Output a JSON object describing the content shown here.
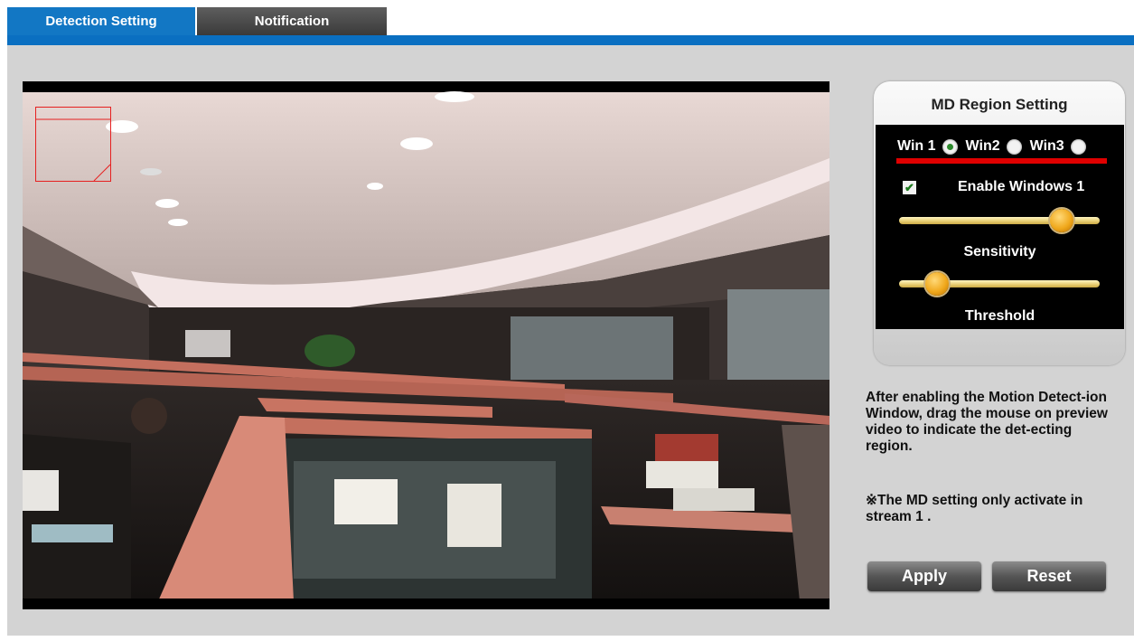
{
  "tabs": [
    {
      "label": "Detection Setting",
      "active": true
    },
    {
      "label": "Notification",
      "active": false
    }
  ],
  "md_panel": {
    "title": "MD Region Setting",
    "windows": [
      {
        "label": "Win 1",
        "selected": true
      },
      {
        "label": "Win2",
        "selected": false
      },
      {
        "label": "Win3",
        "selected": false
      }
    ],
    "enable_label": "Enable Windows 1",
    "enable_checked": true,
    "sensitivity": {
      "label": "Sensitivity",
      "value": 0.85
    },
    "threshold": {
      "label": "Threshold",
      "value": 0.15
    }
  },
  "description": "After enabling the Motion Detect-ion Window, drag the mouse on preview video to indicate the det-ecting region.",
  "note": "※The MD setting only activate in stream 1 .",
  "buttons": {
    "apply": "Apply",
    "reset": "Reset"
  },
  "colors": {
    "accent_blue": "#0a6fc1",
    "region_red": "#e62020",
    "panel_black": "#000000"
  }
}
